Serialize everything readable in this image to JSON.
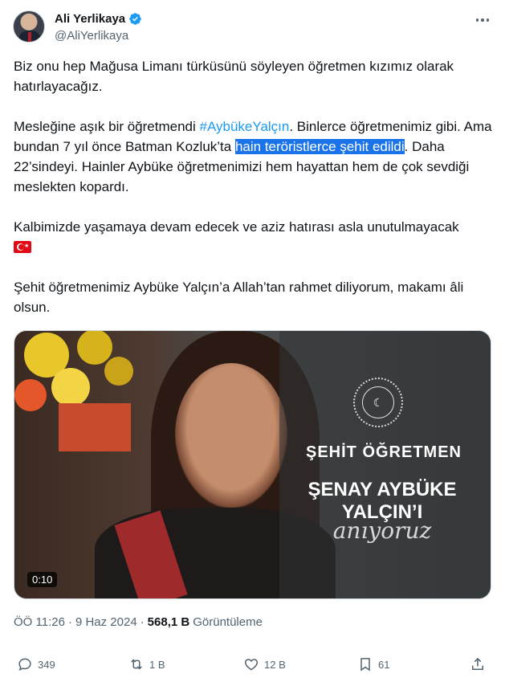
{
  "author": {
    "display_name": "Ali Yerlikaya",
    "handle": "@AliYerlikaya",
    "verified_icon": "verified-badge-icon"
  },
  "tweet": {
    "p1": "Biz onu hep Mağusa Limanı türküsünü söyleyen öğretmen kızımız olarak hatırlayacağız.",
    "p2_a": "Mesleğine aşık bir öğretmendi ",
    "p2_hashtag": "#AybükeYalçın",
    "p2_b": ". Binlerce öğretmenimiz gibi. Ama bundan 7 yıl önce Batman Kozluk’ta ",
    "p2_highlight": "hain teröristlerce şehit edildi",
    "p2_c": ". Daha 22’sindeyi. Hainler Aybüke öğretmenimizi hem hayattan hem de çok sevdiği meslekten kopardı.",
    "p3": "Kalbimizde yaşamaya devam edecek ve aziz hatırası asla unutulmayacak",
    "p4": "Şehit öğretmenimiz Aybüke Yalçın’a Allah’tan rahmet diliyorum, makamı âli olsun."
  },
  "media": {
    "title": "ŞEHİT ÖĞRETMEN",
    "name": "ŞENAY AYBÜKE YALÇIN’I",
    "script": "anıyoruz",
    "duration": "0:10"
  },
  "meta": {
    "time": "ÖÖ 11:26",
    "sep": "·",
    "date": "9 Haz 2024",
    "sep2": "·",
    "views": "568,1 B",
    "views_label": "Görüntüleme"
  },
  "actions": {
    "replies": "349",
    "retweets": "1 B",
    "likes": "12 B",
    "bookmarks": "61"
  },
  "colors": {
    "accent": "#1d9bf0",
    "highlight": "#1a73e8",
    "text": "#0f1419",
    "secondary": "#536471"
  }
}
